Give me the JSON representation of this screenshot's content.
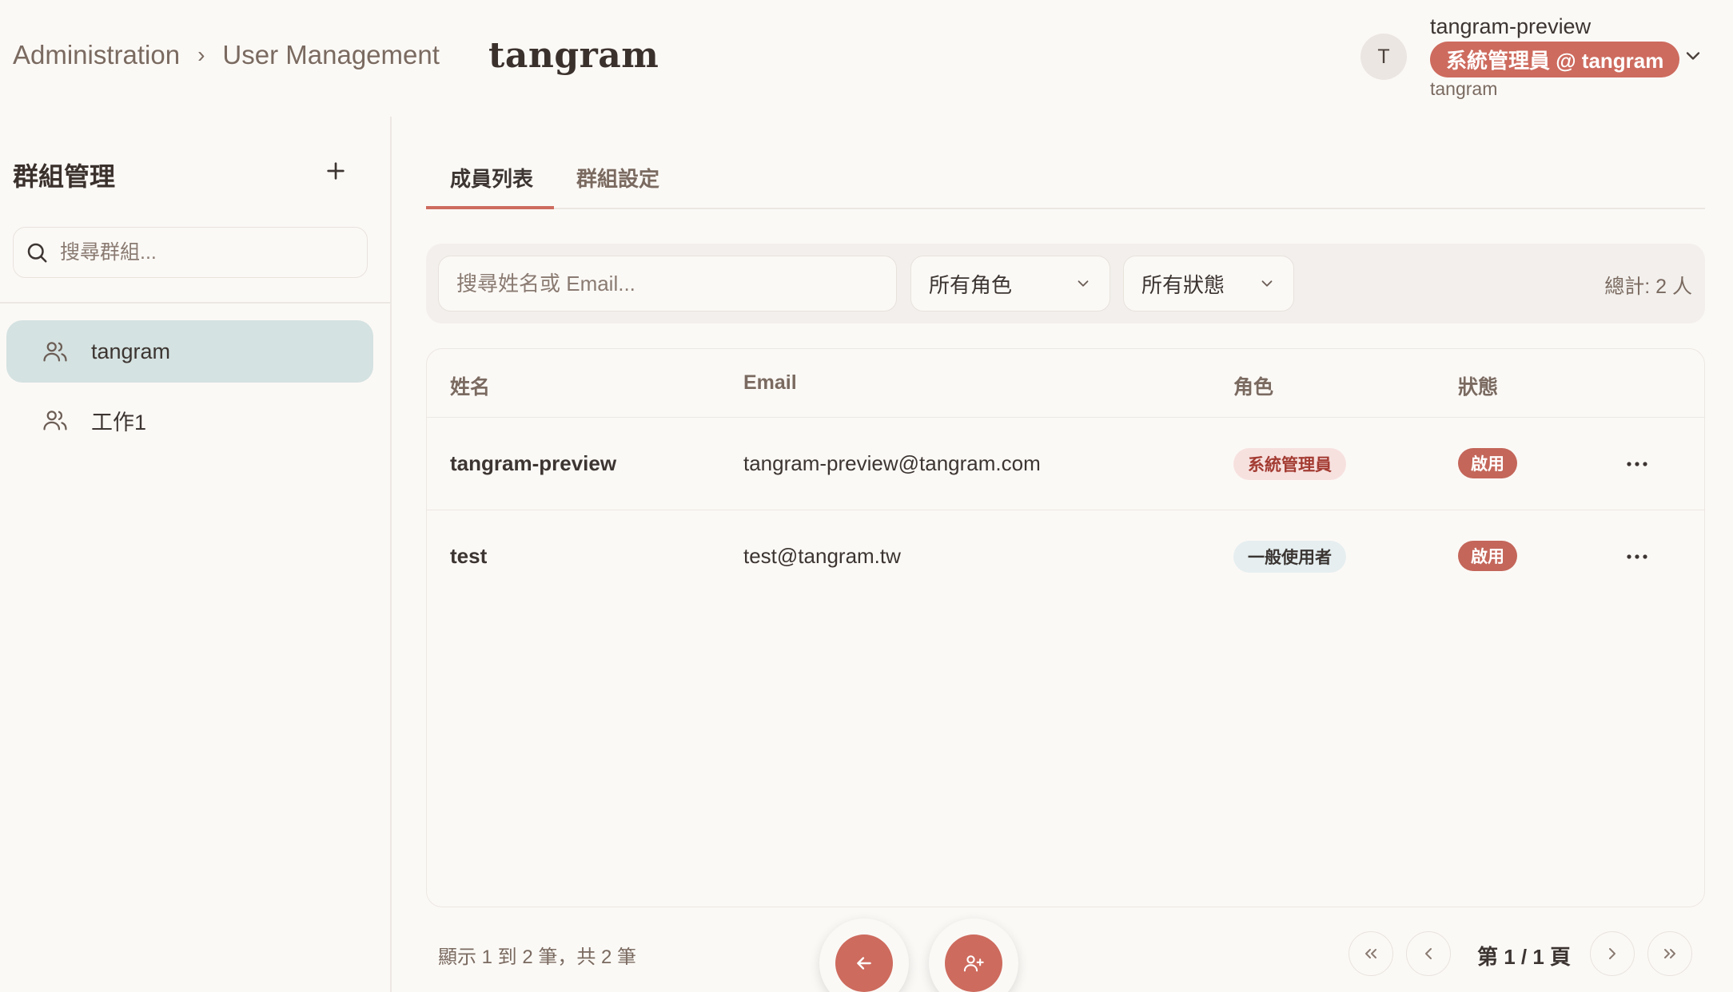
{
  "header": {
    "breadcrumb": [
      "Administration",
      "User Management"
    ],
    "brand": "tangram",
    "user": {
      "avatar_letter": "T",
      "name": "tangram-preview",
      "badge": "系統管理員 @ tangram",
      "org": "tangram"
    }
  },
  "sidebar": {
    "title": "群組管理",
    "search_placeholder": "搜尋群組...",
    "groups": [
      {
        "label": "tangram",
        "active": true
      },
      {
        "label": "工作1",
        "active": false
      }
    ]
  },
  "tabs": [
    {
      "label": "成員列表",
      "active": true
    },
    {
      "label": "群組設定",
      "active": false
    }
  ],
  "filters": {
    "search_placeholder": "搜尋姓名或 Email...",
    "role_select": "所有角色",
    "status_select": "所有狀態",
    "total": "總計: 2 人"
  },
  "table": {
    "headers": {
      "name": "姓名",
      "email": "Email",
      "role": "角色",
      "status": "狀態"
    },
    "rows": [
      {
        "name": "tangram-preview",
        "email": "tangram-preview@tangram.com",
        "role": "系統管理員",
        "status": "啟用"
      },
      {
        "name": "test",
        "email": "test@tangram.tw",
        "role": "一般使用者",
        "status": "啟用"
      }
    ]
  },
  "footer": {
    "showing": "顯示 1 到 2 筆，共 2 筆",
    "page_label": "第 1 / 1 頁"
  },
  "colors": {
    "accent": "#cd6b5e",
    "active_group_bg": "#d4e2e1",
    "background": "#fbf9f6"
  }
}
